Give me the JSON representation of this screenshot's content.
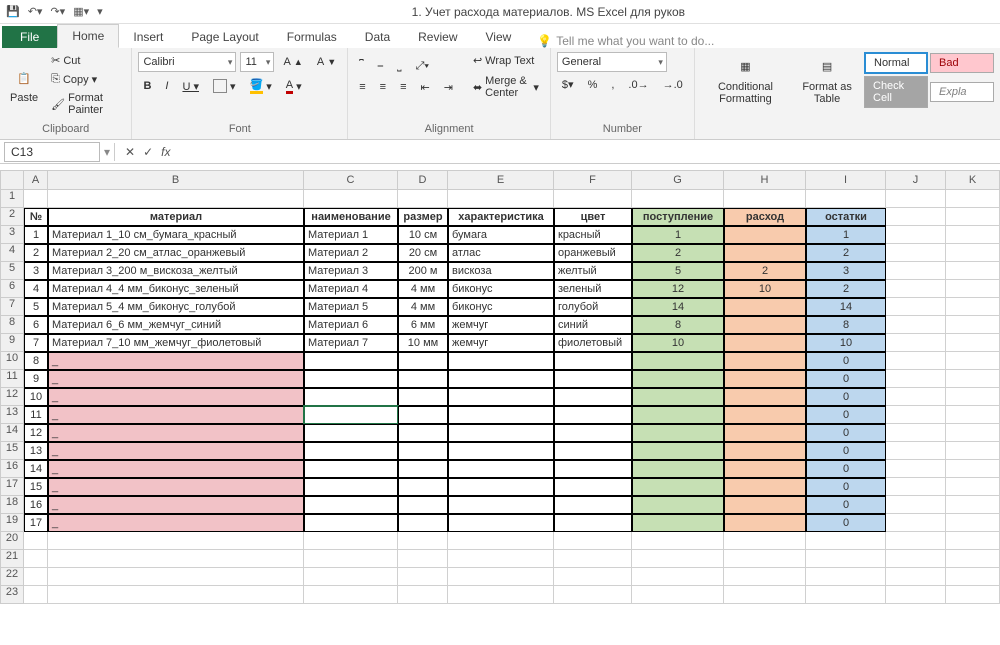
{
  "titlebar": {
    "title": "1. Учет расхода материалов. MS Excel для руков"
  },
  "tabs": {
    "file": "File",
    "home": "Home",
    "insert": "Insert",
    "page_layout": "Page Layout",
    "formulas": "Formulas",
    "data": "Data",
    "review": "Review",
    "view": "View",
    "tell": "Tell me what you want to do..."
  },
  "ribbon": {
    "paste": "Paste",
    "cut": "Cut",
    "copy": "Copy",
    "format_painter": "Format Painter",
    "clipboard": "Clipboard",
    "font_name": "Calibri",
    "font_size": "11",
    "font_label": "Font",
    "wrap": "Wrap Text",
    "merge": "Merge & Center",
    "alignment": "Alignment",
    "num_format": "General",
    "number": "Number",
    "cond_fmt": "Conditional Formatting",
    "fmt_table": "Format as Table",
    "normal": "Normal",
    "bad": "Bad",
    "check": "Check Cell",
    "expl": "Expla"
  },
  "namebox": "C13",
  "formula": "",
  "cols": [
    "A",
    "B",
    "C",
    "D",
    "E",
    "F",
    "G",
    "H",
    "I",
    "J",
    "K"
  ],
  "headers": {
    "no": "№",
    "material": "материал",
    "name": "наименование",
    "size": "размер",
    "char": "характеристика",
    "color": "цвет",
    "in": "поступление",
    "out": "расход",
    "bal": "остатки"
  },
  "rows": [
    {
      "n": "1",
      "mat": "Материал 1_10 см_бумага_красный",
      "name": "Материал 1",
      "size": "10 см",
      "char": "бумага",
      "color": "красный",
      "in": "1",
      "out": "",
      "bal": "1"
    },
    {
      "n": "2",
      "mat": "Материал 2_20 см_атлас_оранжевый",
      "name": "Материал 2",
      "size": "20 см",
      "char": "атлас",
      "color": "оранжевый",
      "in": "2",
      "out": "",
      "bal": "2"
    },
    {
      "n": "3",
      "mat": "Материал 3_200 м_вискоза_желтый",
      "name": "Материал 3",
      "size": "200 м",
      "char": "вискоза",
      "color": "желтый",
      "in": "5",
      "out": "2",
      "bal": "3"
    },
    {
      "n": "4",
      "mat": "Материал 4_4 мм_биконус_зеленый",
      "name": "Материал 4",
      "size": "4 мм",
      "char": "биконус",
      "color": "зеленый",
      "in": "12",
      "out": "10",
      "bal": "2"
    },
    {
      "n": "5",
      "mat": "Материал 5_4 мм_биконус_голубой",
      "name": "Материал 5",
      "size": "4 мм",
      "char": "биконус",
      "color": "голубой",
      "in": "14",
      "out": "",
      "bal": "14"
    },
    {
      "n": "6",
      "mat": "Материал 6_6 мм_жемчуг_синий",
      "name": "Материал 6",
      "size": "6 мм",
      "char": "жемчуг",
      "color": "синий",
      "in": "8",
      "out": "",
      "bal": "8"
    },
    {
      "n": "7",
      "mat": "Материал 7_10 мм_жемчуг_фиолетовый",
      "name": "Материал 7",
      "size": "10 мм",
      "char": "жемчуг",
      "color": "фиолетовый",
      "in": "10",
      "out": "",
      "bal": "10"
    },
    {
      "n": "8",
      "mat": "_",
      "name": "",
      "size": "",
      "char": "",
      "color": "",
      "in": "",
      "out": "",
      "bal": "0"
    },
    {
      "n": "9",
      "mat": "_",
      "name": "",
      "size": "",
      "char": "",
      "color": "",
      "in": "",
      "out": "",
      "bal": "0"
    },
    {
      "n": "10",
      "mat": "_",
      "name": "",
      "size": "",
      "char": "",
      "color": "",
      "in": "",
      "out": "",
      "bal": "0"
    },
    {
      "n": "11",
      "mat": "_",
      "name": "",
      "size": "",
      "char": "",
      "color": "",
      "in": "",
      "out": "",
      "bal": "0"
    },
    {
      "n": "12",
      "mat": "_",
      "name": "",
      "size": "",
      "char": "",
      "color": "",
      "in": "",
      "out": "",
      "bal": "0"
    },
    {
      "n": "13",
      "mat": "_",
      "name": "",
      "size": "",
      "char": "",
      "color": "",
      "in": "",
      "out": "",
      "bal": "0"
    },
    {
      "n": "14",
      "mat": "_",
      "name": "",
      "size": "",
      "char": "",
      "color": "",
      "in": "",
      "out": "",
      "bal": "0"
    },
    {
      "n": "15",
      "mat": "_",
      "name": "",
      "size": "",
      "char": "",
      "color": "",
      "in": "",
      "out": "",
      "bal": "0"
    },
    {
      "n": "16",
      "mat": "_",
      "name": "",
      "size": "",
      "char": "",
      "color": "",
      "in": "",
      "out": "",
      "bal": "0"
    },
    {
      "n": "17",
      "mat": "_",
      "name": "",
      "size": "",
      "char": "",
      "color": "",
      "in": "",
      "out": "",
      "bal": "0"
    }
  ],
  "colors": {
    "pink": "#f2c2c7",
    "green": "#c6e0b4",
    "orange": "#f8cbad",
    "blue": "#bdd7ee"
  }
}
